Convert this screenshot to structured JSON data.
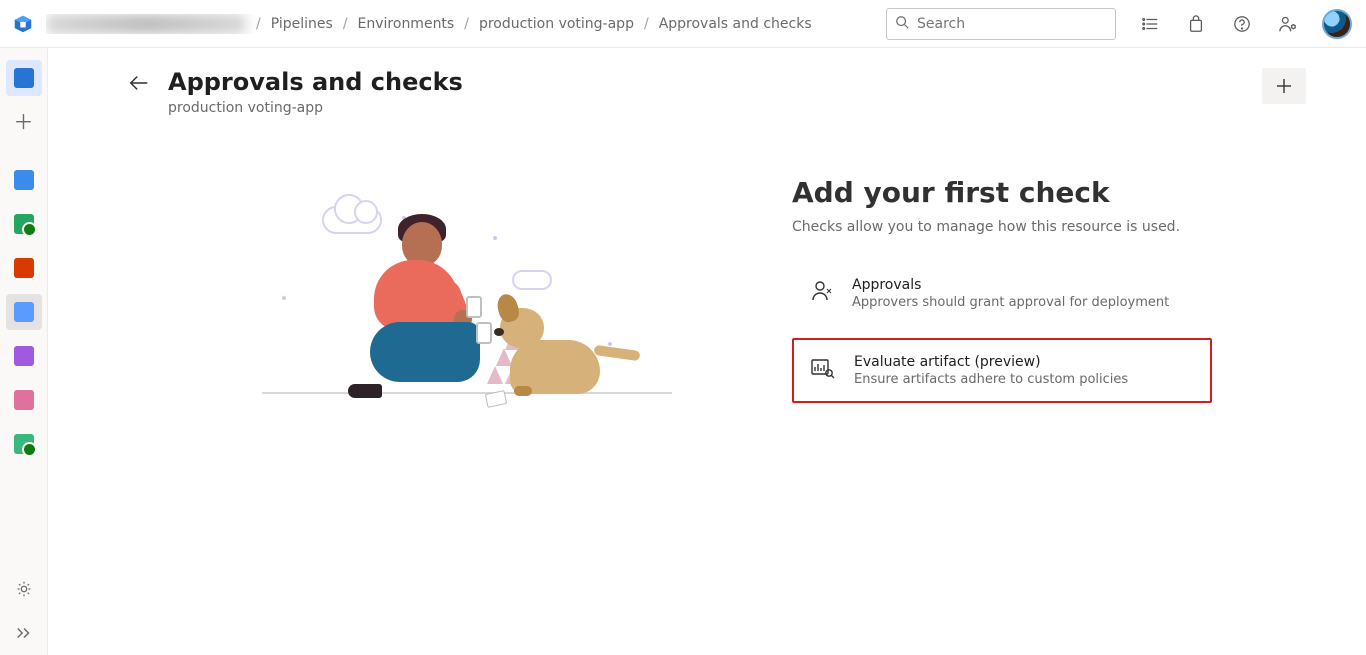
{
  "topbar": {
    "search_placeholder": "Search",
    "breadcrumbs": [
      "Pipelines",
      "Environments",
      "production voting-app",
      "Approvals and checks"
    ]
  },
  "header": {
    "title": "Approvals and checks",
    "subtitle": "production voting-app"
  },
  "cta": {
    "heading": "Add your first check",
    "description": "Checks allow you to manage how this resource is used.",
    "options": [
      {
        "title": "Approvals",
        "desc": "Approvers should grant approval for deployment"
      },
      {
        "title": "Evaluate artifact (preview)",
        "desc": "Ensure artifacts adhere to custom policies"
      }
    ]
  }
}
